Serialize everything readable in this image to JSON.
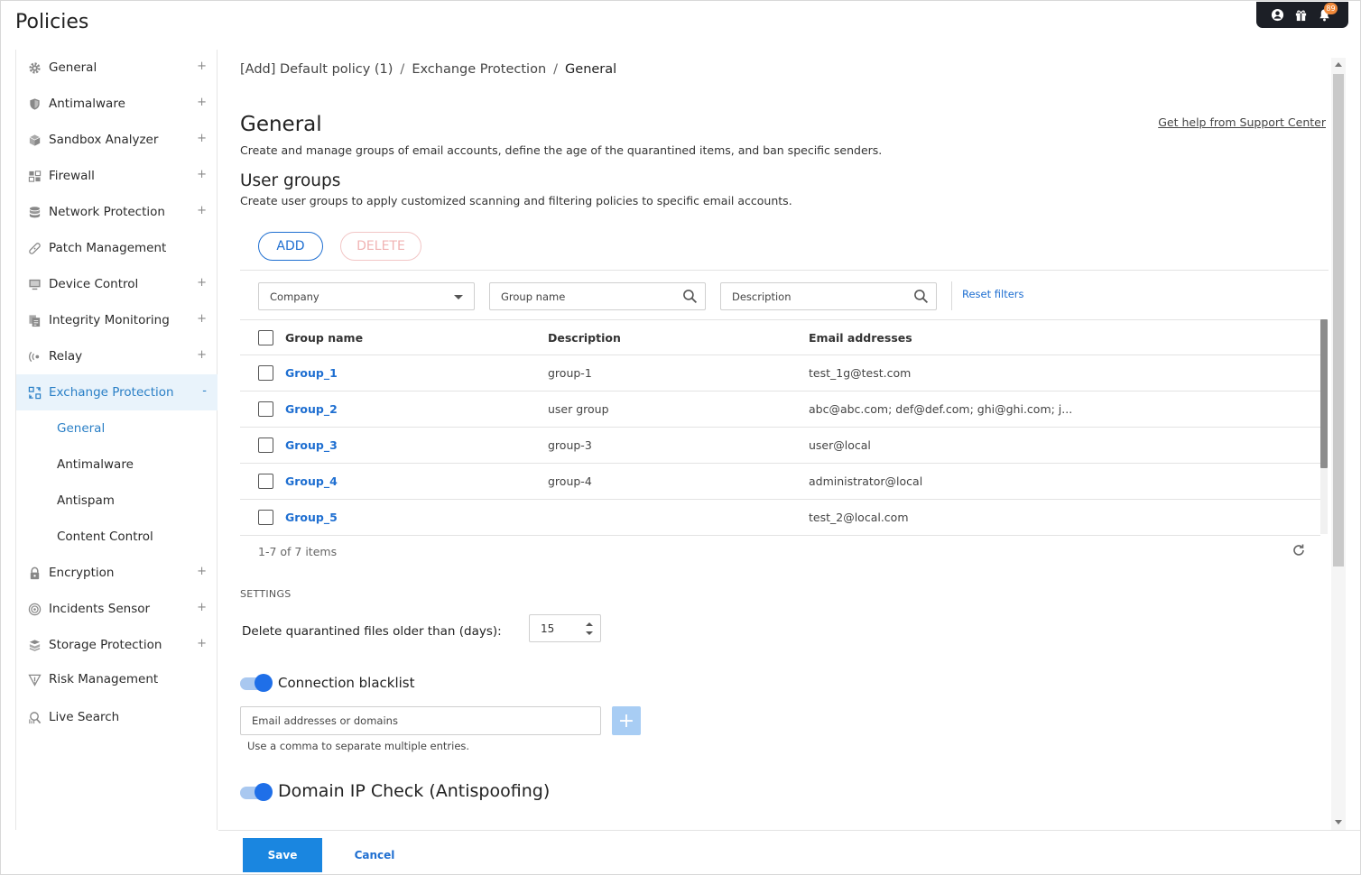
{
  "page": {
    "title": "Policies"
  },
  "topbar": {
    "notification_count": "89"
  },
  "sidebar": {
    "items": [
      {
        "label": "General",
        "icon": "gear-icon",
        "expandable": "+"
      },
      {
        "label": "Antimalware",
        "icon": "shield-icon",
        "expandable": "+"
      },
      {
        "label": "Sandbox Analyzer",
        "icon": "cube-icon",
        "expandable": "+"
      },
      {
        "label": "Firewall",
        "icon": "firewall-icon",
        "expandable": "+"
      },
      {
        "label": "Network Protection",
        "icon": "database-icon",
        "expandable": "+"
      },
      {
        "label": "Patch Management",
        "icon": "patch-icon",
        "expandable": ""
      },
      {
        "label": "Device Control",
        "icon": "monitor-icon",
        "expandable": "+"
      },
      {
        "label": "Integrity Monitoring",
        "icon": "documents-icon",
        "expandable": "+"
      },
      {
        "label": "Relay",
        "icon": "relay-icon",
        "expandable": "+"
      },
      {
        "label": "Exchange Protection",
        "icon": "exchange-icon",
        "expandable": "-"
      },
      {
        "label": "Encryption",
        "icon": "lock-icon",
        "expandable": "+"
      },
      {
        "label": "Incidents Sensor",
        "icon": "sensor-icon",
        "expandable": "+"
      },
      {
        "label": "Storage Protection",
        "icon": "storage-icon",
        "expandable": "+"
      },
      {
        "label": "Risk Management",
        "icon": "risk-icon",
        "expandable": ""
      },
      {
        "label": "Live Search",
        "icon": "live-search-icon",
        "expandable": ""
      }
    ],
    "exchange_sub": [
      "General",
      "Antimalware",
      "Antispam",
      "Content Control"
    ]
  },
  "breadcrumb": [
    "[Add] Default policy (1)",
    "/",
    "Exchange Protection",
    "/",
    "General"
  ],
  "help_link": "Get help from Support Center",
  "general": {
    "title": "General",
    "description": "Create and manage groups of email accounts, define the age of the quarantined items, and ban specific senders."
  },
  "user_groups": {
    "title": "User groups",
    "description": "Create user groups to apply customized scanning and filtering policies to specific email accounts.",
    "add_label": "ADD",
    "delete_label": "DELETE",
    "filters": {
      "company": "Company",
      "group_name": "Group name",
      "description": "Description",
      "reset": "Reset filters"
    },
    "columns": [
      "Group name",
      "Description",
      "Email addresses"
    ],
    "rows": [
      {
        "name": "Group_1",
        "description": "group-1",
        "emails": "test_1g@test.com"
      },
      {
        "name": "Group_2",
        "description": "user group",
        "emails": "abc@abc.com; def@def.com; ghi@ghi.com; j..."
      },
      {
        "name": "Group_3",
        "description": "group-3",
        "emails": "user@local"
      },
      {
        "name": "Group_4",
        "description": "group-4",
        "emails": "administrator@local"
      },
      {
        "name": "Group_5",
        "description": "",
        "emails": "test_2@local.com"
      }
    ],
    "pager": "1-7 of 7 items"
  },
  "settings": {
    "heading": "SETTINGS",
    "delete_label": "Delete quarantined files older than (days):",
    "delete_value": "15",
    "blacklist_label": "Connection blacklist",
    "blacklist_enabled": true,
    "blacklist_placeholder": "Email addresses or domains",
    "blacklist_add": "+",
    "blacklist_hint": "Use a comma to separate multiple entries.",
    "domain_check_label": "Domain IP Check (Antispoofing)",
    "domain_check_enabled": true
  },
  "footer": {
    "save": "Save",
    "cancel": "Cancel"
  },
  "colors": {
    "accent": "#1f6fd1",
    "active_bg": "#e9f3fb",
    "save_bg": "#1a86e0",
    "toggle_knob": "#1f6fe8"
  }
}
